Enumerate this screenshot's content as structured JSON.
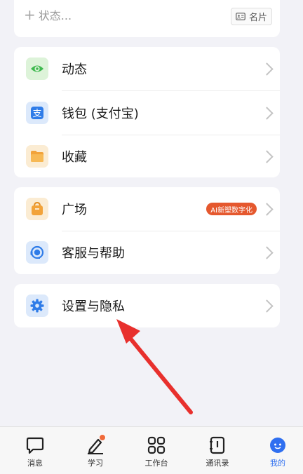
{
  "profile": {
    "status_placeholder": "状态...",
    "card_button_label": "名片"
  },
  "menu_group_1": [
    {
      "label": "动态",
      "icon": "eye-icon",
      "icon_color": "#3fb94f",
      "bg": "#ddf3d9"
    },
    {
      "label": "钱包 (支付宝)",
      "icon": "alipay-icon",
      "icon_color": "#2f7ce8",
      "bg": "#dce9fb"
    },
    {
      "label": "收藏",
      "icon": "folder-icon",
      "icon_color": "#f2a33a",
      "bg": "#fbecd3"
    }
  ],
  "menu_group_2": [
    {
      "label": "广场",
      "icon": "bag-icon",
      "icon_color": "#f2a33a",
      "bg": "#fbecd3",
      "badge": "AI新塑数字化"
    },
    {
      "label": "客服与帮助",
      "icon": "headset-icon",
      "icon_color": "#2f7ce8",
      "bg": "#dce9fb"
    }
  ],
  "menu_group_3": [
    {
      "label": "设置与隐私",
      "icon": "gear-icon",
      "icon_color": "#2f7ce8",
      "bg": "#dce9fb"
    }
  ],
  "tabbar": [
    {
      "label": "消息",
      "icon": "chat-icon"
    },
    {
      "label": "学习",
      "icon": "pen-icon",
      "has_dot": true
    },
    {
      "label": "工作台",
      "icon": "grid-icon"
    },
    {
      "label": "通讯录",
      "icon": "contacts-icon"
    },
    {
      "label": "我的",
      "icon": "avatar-icon",
      "active": true
    }
  ],
  "colors": {
    "accent": "#2f6ff0",
    "arrow": "#e8302d",
    "badge": "#e5582e"
  }
}
